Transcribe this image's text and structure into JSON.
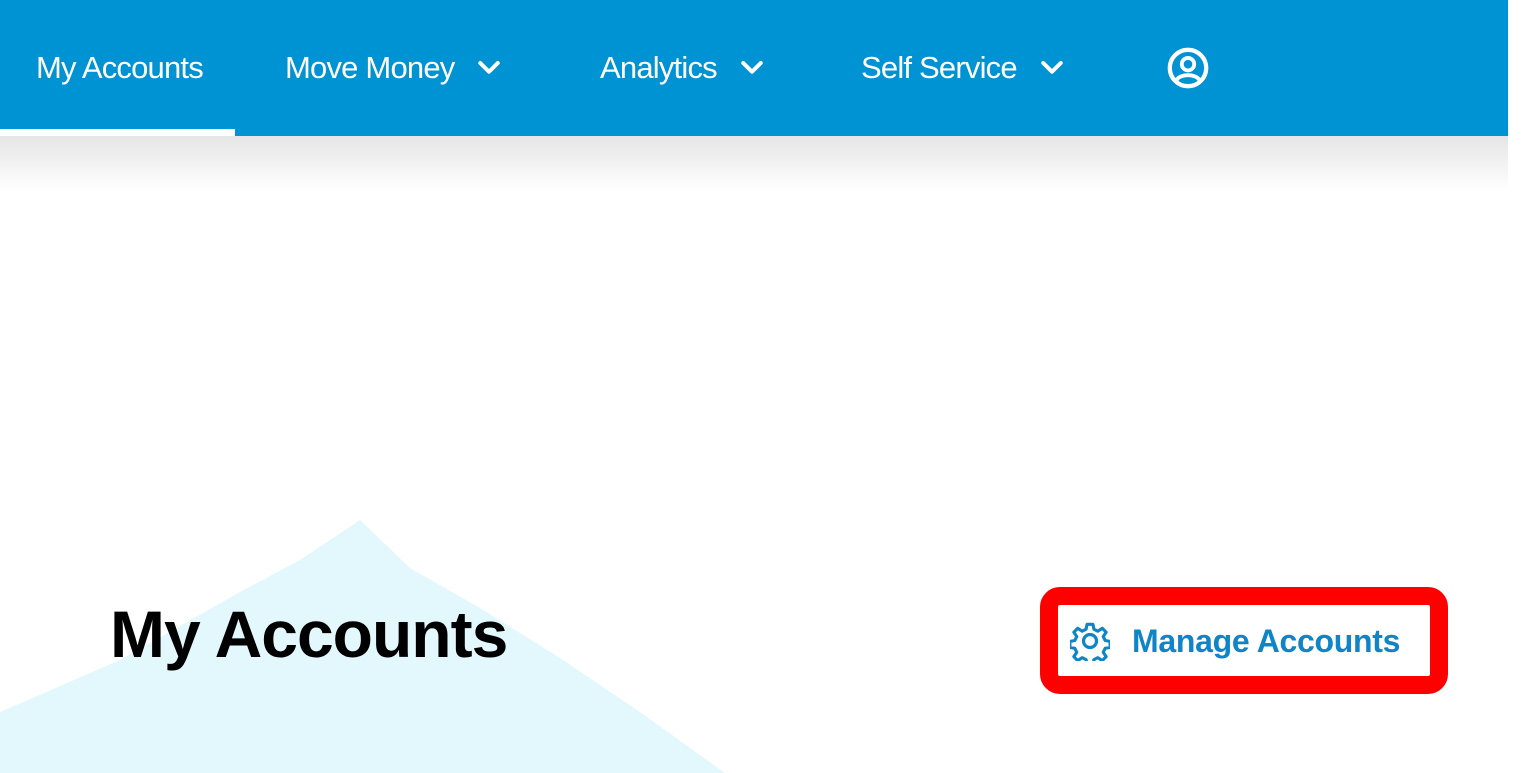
{
  "nav": {
    "items": [
      {
        "label": "My Accounts",
        "active": true
      },
      {
        "label": "Move Money",
        "icon": "chevron-down-icon"
      },
      {
        "label": "Analytics",
        "icon": "chevron-down-icon"
      },
      {
        "label": "Self Service",
        "icon": "chevron-down-icon"
      }
    ],
    "profile_icon": "user-circle-icon",
    "background_color": "#0093d3"
  },
  "main": {
    "title": "My Accounts",
    "manage_button": {
      "label": "Manage Accounts",
      "icon": "gear-icon",
      "color": "#0f84c7"
    },
    "highlight_color": "#ff0000",
    "decoration_color": "#e3f8fd"
  }
}
